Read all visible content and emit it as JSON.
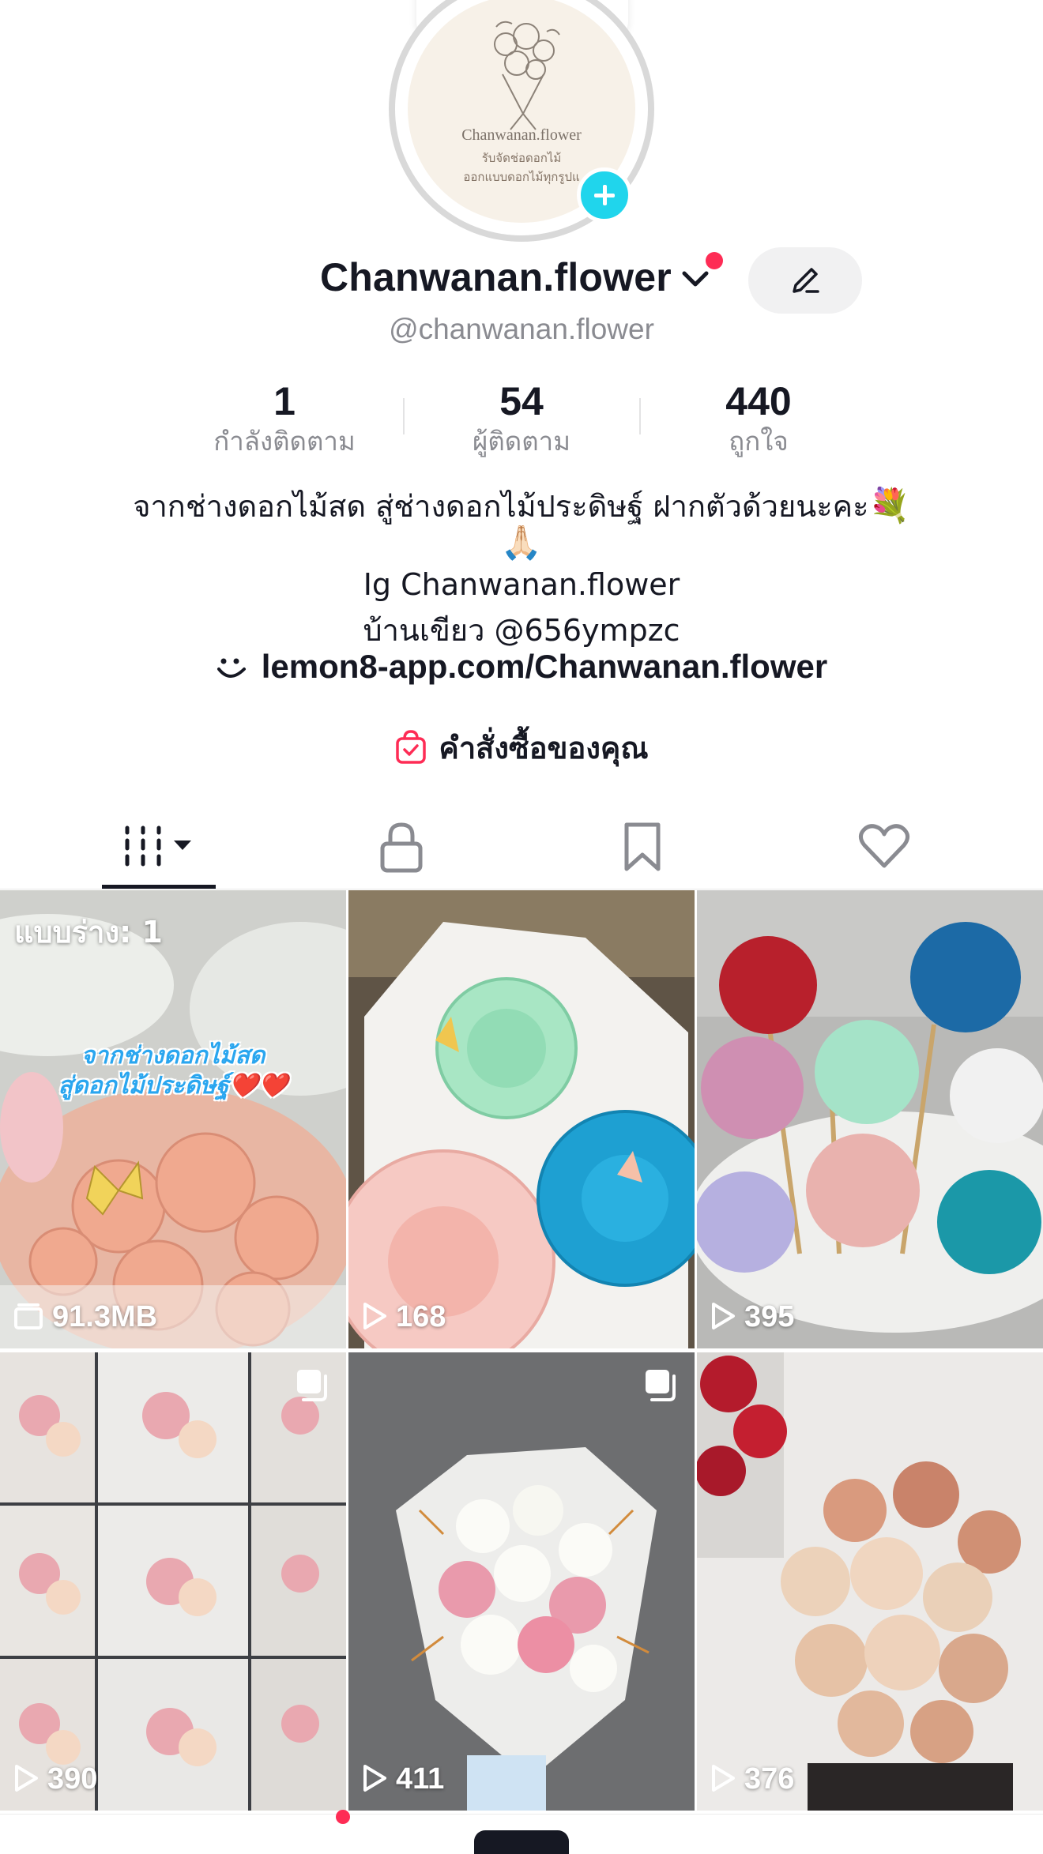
{
  "profile": {
    "display_name": "Chanwanan.flower",
    "handle": "@chanwanan.flower",
    "avatar_text": {
      "name": "Chanwanan.flower",
      "line1": "รับจัดช่อดอกไม้",
      "line2": "ออกแบบดอกไม้ทุกรูปแ"
    }
  },
  "stats": [
    {
      "value": "1",
      "label": "กำลังติดตาม"
    },
    {
      "value": "54",
      "label": "ผู้ติดตาม"
    },
    {
      "value": "440",
      "label": "ถูกใจ"
    }
  ],
  "bio": {
    "line1": "จากช่างดอกไม้สด สู่ช่างดอกไม้ประดิษฐ์ ฝากตัวด้วยนะคะ",
    "line1_emoji": "💐",
    "line2_emoji": "🙏🏻",
    "line3": "Ig Chanwanan.flower",
    "line4": "บ้านเขียว @656ympzc"
  },
  "link": {
    "text": "lemon8-app.com/Chanwanan.flower",
    "icon": "lemon8-icon"
  },
  "orders": {
    "text": "คำสั่งซื้อของคุณ",
    "icon": "shopping-bag-icon"
  },
  "tabs": [
    {
      "name": "videos",
      "icon": "grid-icon",
      "active": true
    },
    {
      "name": "private",
      "icon": "lock-icon",
      "active": false
    },
    {
      "name": "saved",
      "icon": "bookmark-icon",
      "active": false
    },
    {
      "name": "liked",
      "icon": "heart-icon",
      "active": false
    }
  ],
  "grid": [
    {
      "type": "draft",
      "label": "แบบร่าง: 1",
      "caption_line1": "จากช่างดอกไม้สด",
      "caption_line2": "สู่ดอกไม้ประดิษฐ์",
      "caption_emoji": "❤️❤️",
      "count": "91.3MB",
      "count_icon": "storage-icon"
    },
    {
      "type": "video",
      "count": "168",
      "count_icon": "play-icon"
    },
    {
      "type": "video",
      "count": "395",
      "count_icon": "play-icon"
    },
    {
      "type": "photo",
      "count": "390",
      "count_icon": "play-icon",
      "badge": "multi-photo-icon"
    },
    {
      "type": "photo",
      "count": "411",
      "count_icon": "play-icon",
      "badge": "multi-photo-icon"
    },
    {
      "type": "video",
      "count": "376",
      "count_icon": "play-icon"
    }
  ],
  "colors": {
    "accent": "#fe2c55",
    "add_button": "#20d5ec",
    "text": "#161823",
    "muted": "#8a8b91"
  }
}
